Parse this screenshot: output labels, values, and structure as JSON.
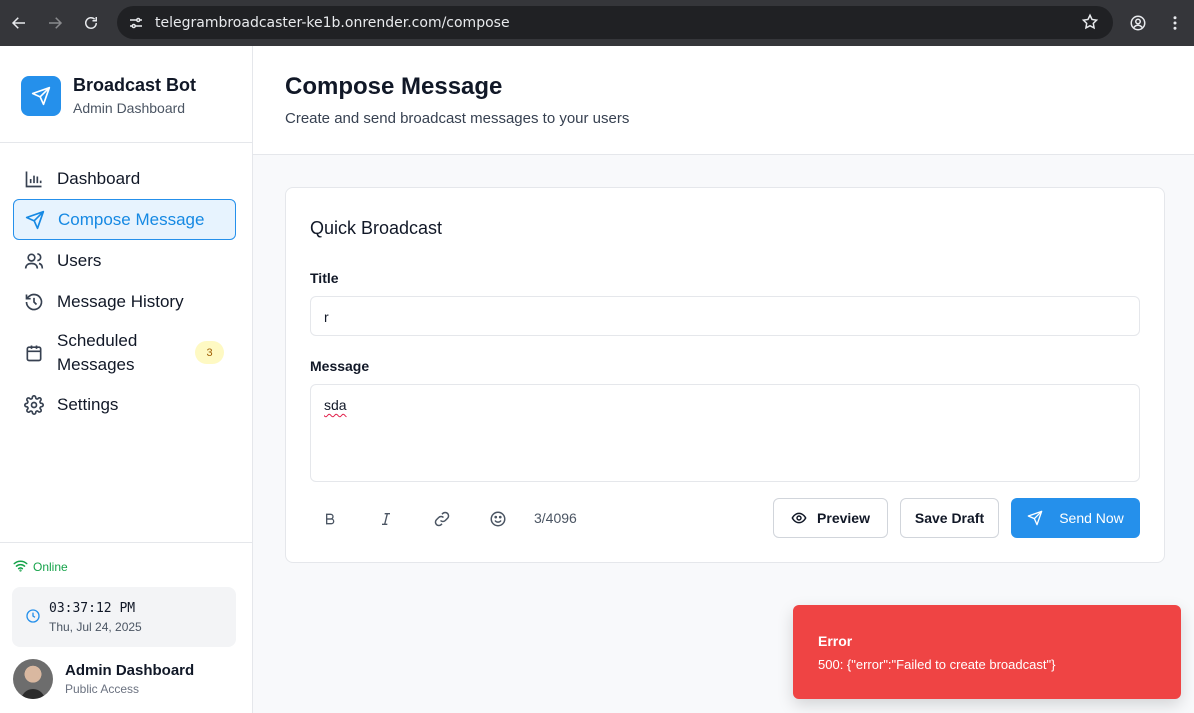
{
  "browser": {
    "url": "telegrambroadcaster-ke1b.onrender.com/compose"
  },
  "brand": {
    "title": "Broadcast Bot",
    "subtitle": "Admin Dashboard",
    "accent": "#2590eb"
  },
  "nav": {
    "items": [
      {
        "label": "Dashboard",
        "icon": "bar-chart-icon"
      },
      {
        "label": "Compose Message",
        "icon": "send-icon",
        "active": true
      },
      {
        "label": "Users",
        "icon": "users-icon"
      },
      {
        "label": "Message History",
        "icon": "history-icon"
      },
      {
        "label": "Scheduled Messages",
        "icon": "calendar-icon",
        "badge": "3"
      },
      {
        "label": "Settings",
        "icon": "gear-icon"
      }
    ]
  },
  "status": {
    "label": "Online",
    "color": "#16a34a"
  },
  "clock": {
    "time": "03:37:12 PM",
    "date": "Thu, Jul 24, 2025"
  },
  "user": {
    "name": "Admin Dashboard",
    "access": "Public Access"
  },
  "header": {
    "title": "Compose Message",
    "subtitle": "Create and send broadcast messages to your users"
  },
  "form": {
    "card_title": "Quick Broadcast",
    "title_label": "Title",
    "title_value": "r",
    "message_label": "Message",
    "message_value": "sda",
    "char_count": "3/4096",
    "preview_label": "Preview",
    "draft_label": "Save Draft",
    "send_label": "Send Now"
  },
  "toast": {
    "title": "Error",
    "message": "500: {\"error\":\"Failed to create broadcast\"}",
    "color": "#ef4444"
  }
}
